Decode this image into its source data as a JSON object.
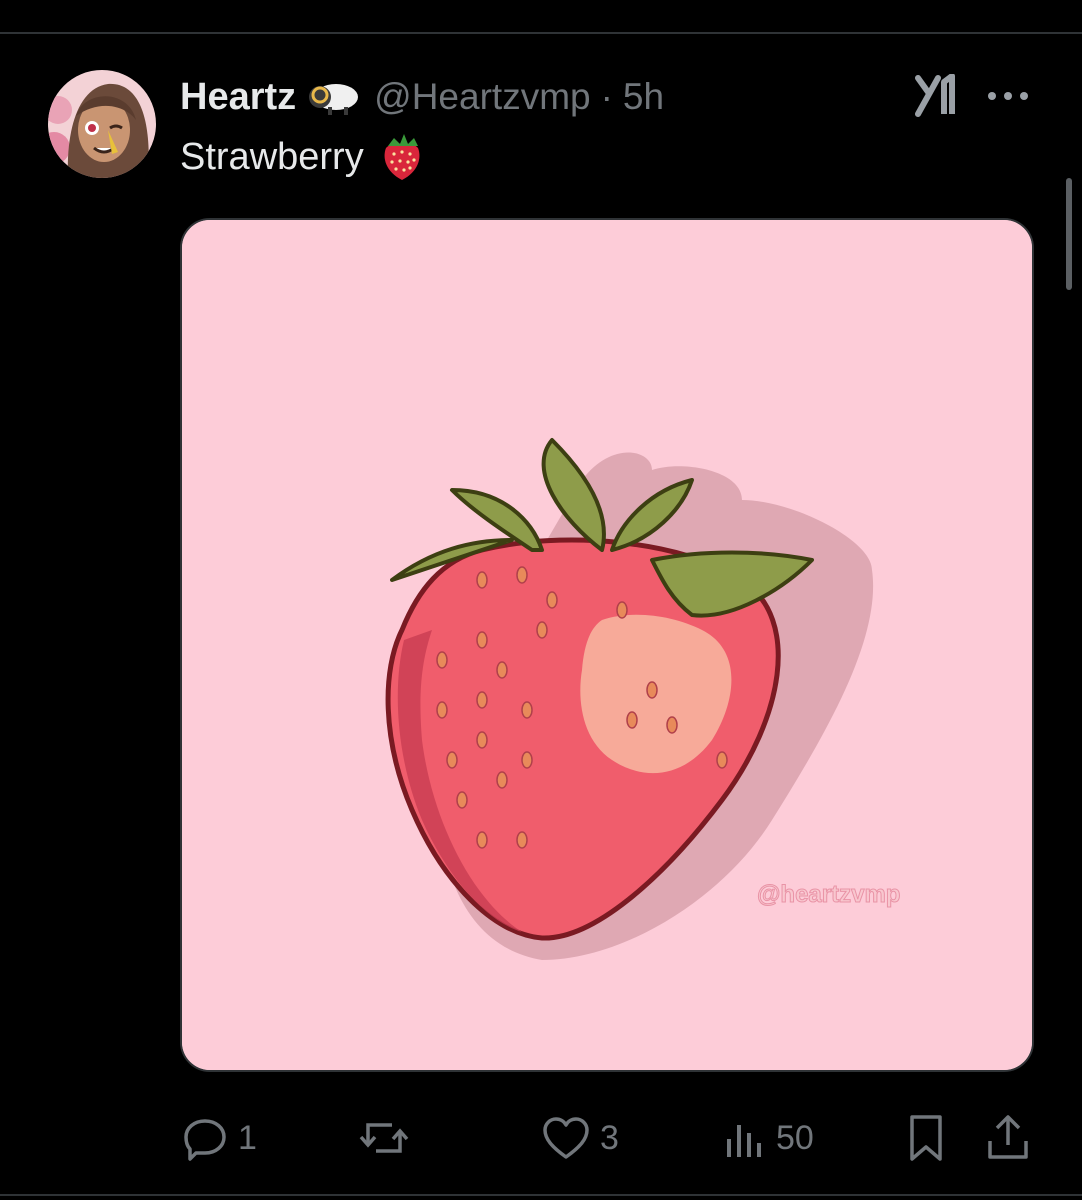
{
  "tweet": {
    "display_name": "Heartz",
    "handle": "@Heartzvmp",
    "separator": "·",
    "timestamp": "5h",
    "text": "Strawberry",
    "text_emoji": "strawberry-emoji",
    "badge_icon": "sheep-icon"
  },
  "media": {
    "watermark": "@heartzvmp",
    "background_color": "#fdccd8"
  },
  "actions": {
    "reply_count": "1",
    "repost_count": "",
    "like_count": "3",
    "views_count": "50"
  },
  "icons": {
    "grok": "grok-icon",
    "more": "more-icon",
    "reply": "reply-icon",
    "repost": "repost-icon",
    "like": "heart-icon",
    "views": "views-icon",
    "bookmark": "bookmark-icon",
    "share": "share-icon"
  },
  "colors": {
    "background": "#000000",
    "text": "#e7e9ea",
    "muted": "#71767b",
    "divider": "#2f3336"
  }
}
